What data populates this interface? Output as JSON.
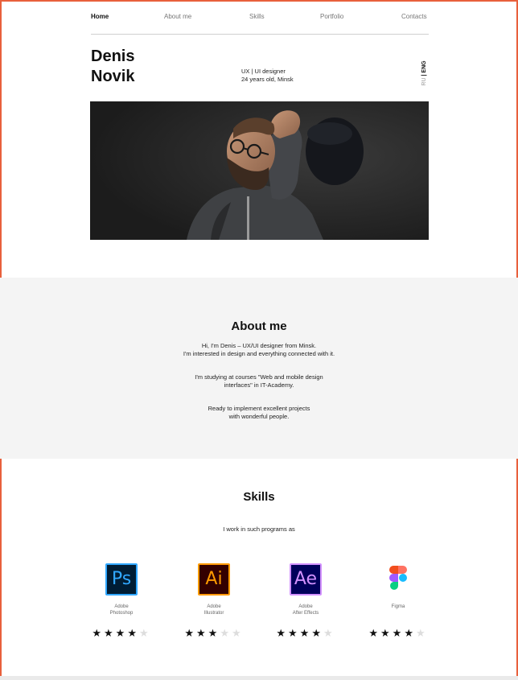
{
  "nav": {
    "items": [
      {
        "label": "Home",
        "active": true
      },
      {
        "label": "About me",
        "active": false
      },
      {
        "label": "Skills",
        "active": false
      },
      {
        "label": "Portfolio",
        "active": false
      },
      {
        "label": "Contacts",
        "active": false
      }
    ]
  },
  "header": {
    "first_name": "Denis",
    "last_name": "Novik",
    "role": "UX | UI designer",
    "details": "24 years old, Minsk",
    "lang_ru": "RU",
    "lang_sep": "|",
    "lang_eng": "ENG"
  },
  "about": {
    "title": "About me",
    "p1_line1": "Hi, I'm Denis – UX/UI designer from Minsk.",
    "p1_line2": "I'm interested in design and everything connected with it.",
    "p2_line1": "I'm studying at courses \"Web and mobile design",
    "p2_line2": "interfaces\" in IT-Academy.",
    "p3_line1": "Ready to implement excellent projects",
    "p3_line2": "with wonderful people."
  },
  "skills": {
    "title": "Skills",
    "subtitle": "I work in such programs as",
    "items": [
      {
        "name": "Adobe\nPhotoshop",
        "icon": "photoshop-icon",
        "abbr": "Ps",
        "rating": 4,
        "max": 5,
        "bg": "#001d34",
        "fg": "#31a8ff"
      },
      {
        "name": "Adobe\nIllustrator",
        "icon": "illustrator-icon",
        "abbr": "Ai",
        "rating": 3,
        "max": 5,
        "bg": "#330000",
        "fg": "#ff9a00"
      },
      {
        "name": "Adobe\nAfter Effects",
        "icon": "after-effects-icon",
        "abbr": "Ae",
        "rating": 4,
        "max": 5,
        "bg": "#00005b",
        "fg": "#d291ff"
      },
      {
        "name": "Figma",
        "icon": "figma-icon",
        "abbr": "",
        "rating": 4,
        "max": 5,
        "bg": "#ffffff",
        "fg": "#000000"
      }
    ]
  },
  "colors": {
    "frame_border": "#e8603c",
    "about_bg": "#f4f4f4",
    "hero_bg": "#262626"
  }
}
